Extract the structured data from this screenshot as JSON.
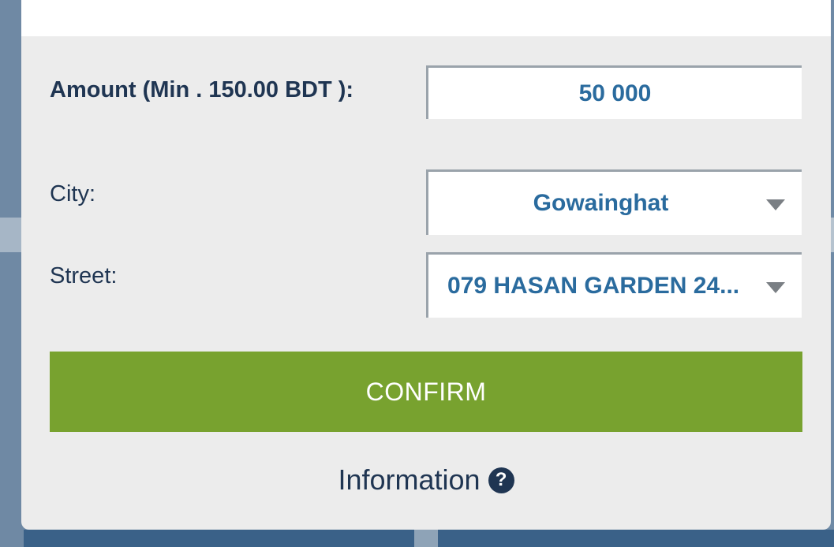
{
  "form": {
    "amount_label": "Amount (Min . 150.00 BDT ):",
    "amount_value": "50 000",
    "city_label": "City:",
    "city_value": "Gowainghat",
    "street_label": "Street:",
    "street_value": "079 HASAN GARDEN 24..."
  },
  "confirm_label": "CONFIRM",
  "info": {
    "label": "Information",
    "icon": "question-circle-icon",
    "icon_glyph": "?"
  },
  "colors": {
    "accent_green": "#78a22f",
    "text_dark": "#1f3552",
    "field_text": "#2a6b9e"
  }
}
